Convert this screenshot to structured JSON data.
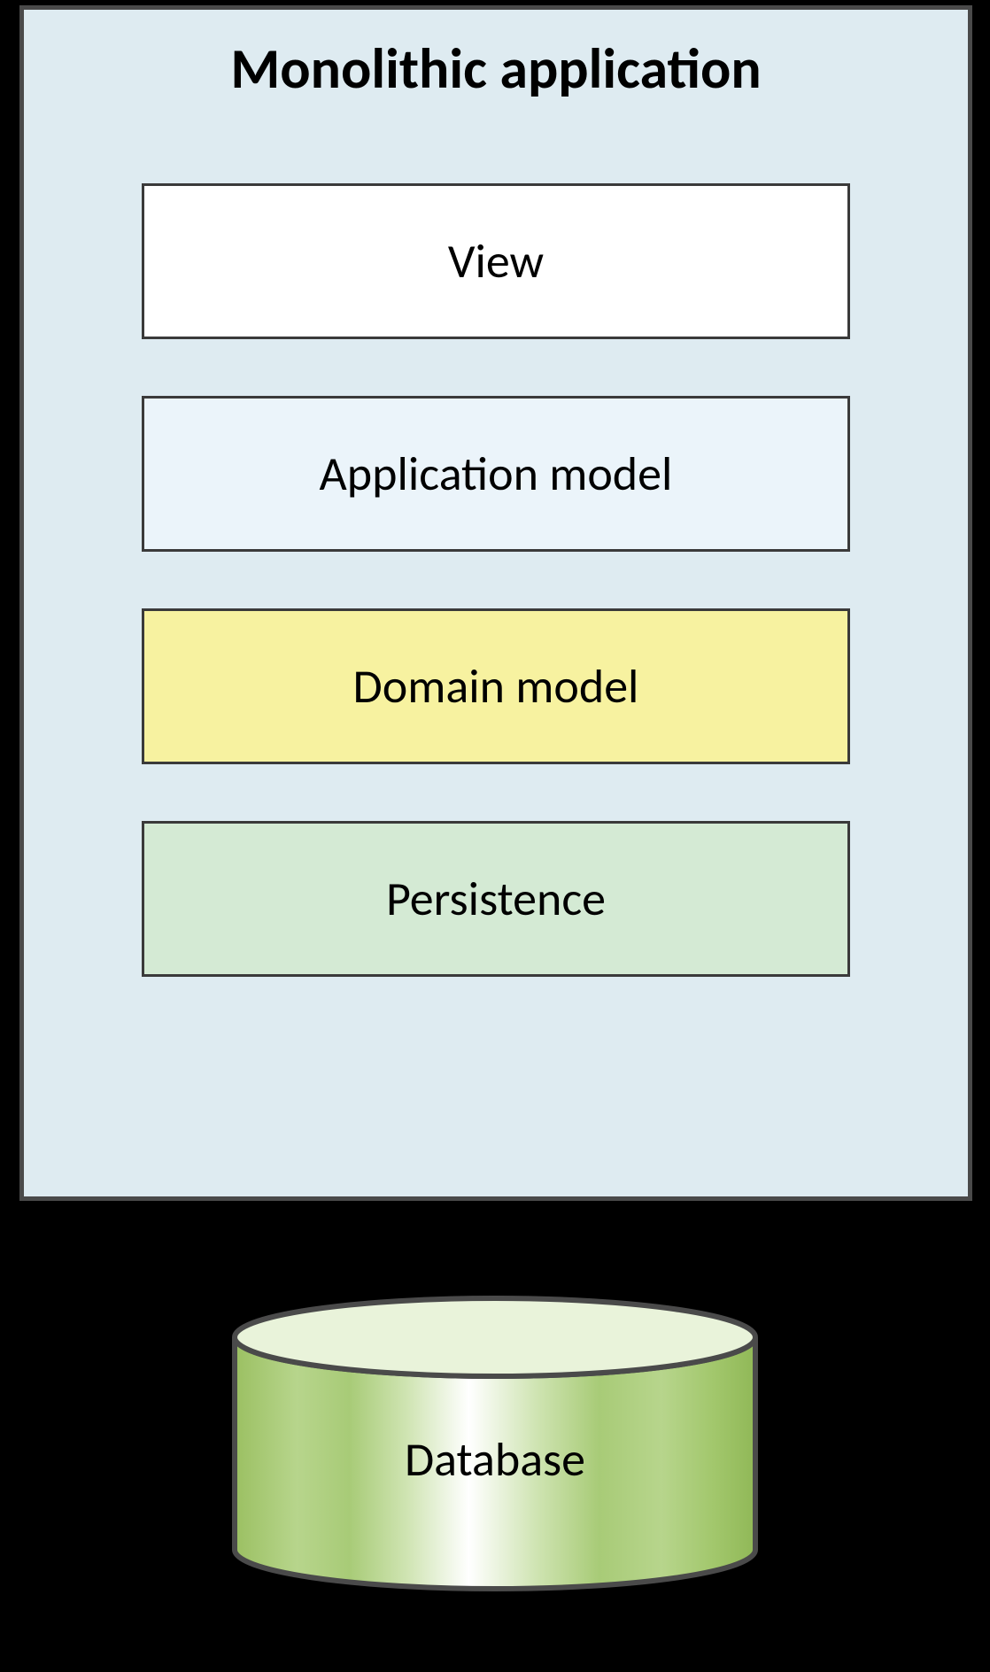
{
  "container": {
    "title": "Monolithic application",
    "bg_color": "#deebf1",
    "border_color": "#4a4a4a"
  },
  "layers": [
    {
      "label": "View",
      "bg_color": "#ffffff"
    },
    {
      "label": "Application model",
      "bg_color": "#ebf4fa"
    },
    {
      "label": "Domain model",
      "bg_color": "#f7f2a0"
    },
    {
      "label": "Persistence",
      "bg_color": "#d4ead4"
    }
  ],
  "database": {
    "label": "Database",
    "fill_color": "#aed07a",
    "stroke_color": "#4a4a4a"
  }
}
